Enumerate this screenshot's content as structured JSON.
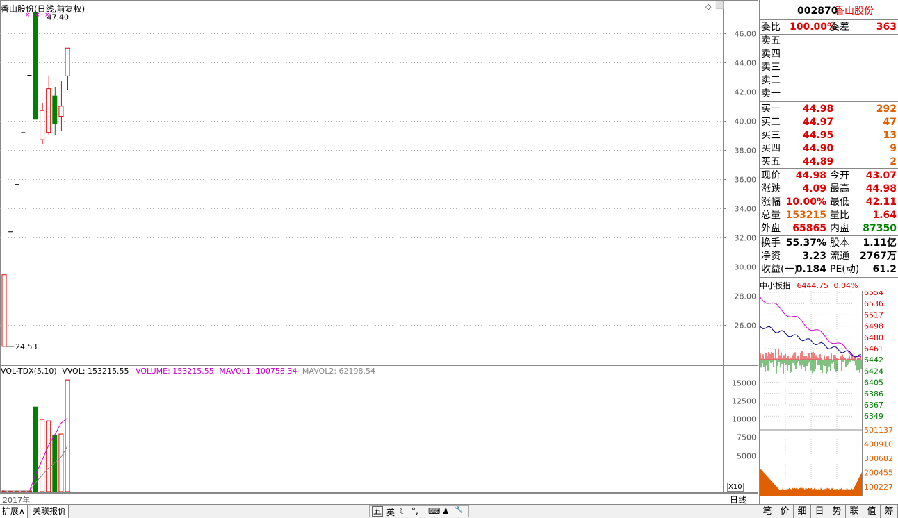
{
  "chart": {
    "title": "香山股份(日线,前复权)",
    "high_label": "47.40",
    "low_label": "24.53",
    "price_ticks": [
      "46.00",
      "44.00",
      "42.00",
      "40.00",
      "38.00",
      "36.00",
      "34.00",
      "32.00",
      "30.00",
      "28.00",
      "26.00"
    ],
    "vol_legend": {
      "name": "VOL-TDX(5,10)",
      "vvol": "VVOL: 153215.55",
      "volume": "VOLUME: 153215.55",
      "mavol1": "MAVOL1: 100758.34",
      "mavol2": "MAVOL2: 62198.54"
    },
    "vol_ticks": [
      "15000",
      "12500",
      "10000",
      "7500",
      "5000"
    ],
    "vol_unit": "X10",
    "year_label": "2017年",
    "period_label": "日线",
    "colors": {
      "up": "#e00000",
      "down": "#008000",
      "ma": "#cc00cc",
      "grid": "#b0b0b0"
    }
  },
  "chart_data": {
    "type": "candlestick",
    "ylim": [
      24.0,
      47.8
    ],
    "vol_ylim": [
      0,
      16000
    ],
    "candles": [
      {
        "open": 24.53,
        "close": 29.44,
        "high": 29.44,
        "low": 24.53,
        "dir": "up",
        "vol": 100
      },
      {
        "open": 32.39,
        "close": 32.39,
        "high": 32.39,
        "low": 32.39,
        "dir": "flat",
        "vol": 100
      },
      {
        "open": 35.63,
        "close": 35.63,
        "high": 35.63,
        "low": 35.63,
        "dir": "flat",
        "vol": 100
      },
      {
        "open": 39.19,
        "close": 39.19,
        "high": 39.19,
        "low": 39.19,
        "dir": "flat",
        "vol": 100
      },
      {
        "open": 43.11,
        "close": 43.11,
        "high": 43.11,
        "low": 43.11,
        "dir": "flat",
        "vol": 100
      },
      {
        "open": 47.4,
        "close": 40.1,
        "high": 47.4,
        "low": 40.1,
        "dir": "down",
        "vol": 11600
      },
      {
        "open": 38.7,
        "close": 40.7,
        "high": 41.2,
        "low": 38.4,
        "dir": "up",
        "vol": 9900
      },
      {
        "open": 39.2,
        "close": 42.2,
        "high": 43.1,
        "low": 39.0,
        "dir": "up",
        "vol": 9700
      },
      {
        "open": 41.7,
        "close": 39.8,
        "high": 42.3,
        "low": 39.0,
        "dir": "down",
        "vol": 7700
      },
      {
        "open": 40.3,
        "close": 41.0,
        "high": 42.7,
        "low": 39.3,
        "dir": "up",
        "vol": 7900
      },
      {
        "open": 43.07,
        "close": 44.98,
        "high": 44.98,
        "low": 42.11,
        "dir": "up",
        "vol": 15320
      }
    ],
    "mavol1": [
      100,
      100,
      100,
      100,
      100,
      2400,
      4300,
      6300,
      7800,
      9400,
      10076
    ],
    "mavol2": [
      100,
      100,
      100,
      100,
      100,
      1250,
      2240,
      3200,
      3970,
      4760,
      6220
    ]
  },
  "quote": {
    "code": "002870",
    "name": "香山股份",
    "weibi_label": "委比",
    "weibi_value": "100.00%",
    "weicha_label": "委差",
    "weicha_value": "363",
    "sell": [
      {
        "label": "卖五",
        "price": "",
        "vol": ""
      },
      {
        "label": "卖四",
        "price": "",
        "vol": ""
      },
      {
        "label": "卖三",
        "price": "",
        "vol": ""
      },
      {
        "label": "卖二",
        "price": "",
        "vol": ""
      },
      {
        "label": "卖一",
        "price": "",
        "vol": ""
      }
    ],
    "buy": [
      {
        "label": "买一",
        "price": "44.98",
        "vol": "292"
      },
      {
        "label": "买二",
        "price": "44.97",
        "vol": "47"
      },
      {
        "label": "买三",
        "price": "44.95",
        "vol": "13"
      },
      {
        "label": "买四",
        "price": "44.90",
        "vol": "9"
      },
      {
        "label": "买五",
        "price": "44.89",
        "vol": "2"
      }
    ],
    "stats1": [
      {
        "l1": "现价",
        "v1": "44.98",
        "c1": "red",
        "l2": "今开",
        "v2": "43.07",
        "c2": "red"
      },
      {
        "l1": "涨跌",
        "v1": "4.09",
        "c1": "red",
        "l2": "最高",
        "v2": "44.98",
        "c2": "red"
      },
      {
        "l1": "涨幅",
        "v1": "10.00%",
        "c1": "red",
        "l2": "最低",
        "v2": "42.11",
        "c2": "red"
      },
      {
        "l1": "总量",
        "v1": "153215",
        "c1": "orange",
        "l2": "量比",
        "v2": "1.64",
        "c2": "red"
      },
      {
        "l1": "外盘",
        "v1": "65865",
        "c1": "red",
        "l2": "内盘",
        "v2": "87350",
        "c2": "green"
      }
    ],
    "stats2": [
      {
        "l1": "换手",
        "v1": "55.37%",
        "l2": "股本",
        "v2": "1.11亿"
      },
      {
        "l1": "净资",
        "v1": "3.23",
        "l2": "流通",
        "v2": "2767万"
      },
      {
        "l1": "收益(一)",
        "v1": "0.184",
        "l2": "PE(动)",
        "v2": "61.2"
      }
    ]
  },
  "index_panel": {
    "name": "中小板指",
    "value": "6444.75",
    "change": "0.04%",
    "price_ticks": [
      "6554",
      "6536",
      "6517",
      "6498",
      "6480",
      "6461",
      "6442",
      "6424",
      "6405",
      "6386",
      "6367",
      "6349"
    ],
    "vol_ticks": [
      "501137",
      "400910",
      "300682",
      "200455",
      "100227"
    ]
  },
  "bottom_tabs": [
    "扩展∧",
    "关联报价"
  ],
  "ime": {
    "items": [
      "五",
      "英",
      "☾",
      "°,",
      "⌨",
      "♟",
      "🔧"
    ]
  },
  "right_tabs": [
    "笔",
    "价",
    "细",
    "日",
    "势",
    "联",
    "值",
    "筹"
  ]
}
